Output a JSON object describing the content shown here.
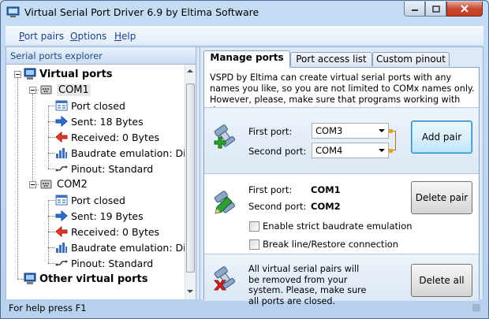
{
  "window": {
    "title": "Virtual Serial Port Driver 6.9 by Eltima Software"
  },
  "menu": {
    "items": [
      {
        "label": "Port pairs",
        "accel": "P",
        "rest": "ort pairs"
      },
      {
        "label": "Options",
        "accel": "O",
        "rest": "ptions"
      },
      {
        "label": "Help",
        "accel": "H",
        "rest": "elp"
      }
    ]
  },
  "explorer": {
    "header": "Serial ports explorer",
    "root_virtual": "Virtual ports",
    "root_other": "Other virtual ports",
    "ports": [
      {
        "name": "COM1",
        "items": [
          {
            "icon": "port-closed-icon",
            "label": "Port closed"
          },
          {
            "icon": "sent-arrow-icon",
            "label": "Sent: 18 Bytes"
          },
          {
            "icon": "received-arrow-icon",
            "label": "Received: 0 Bytes"
          },
          {
            "icon": "baudrate-icon",
            "label": "Baudrate emulation: Dis"
          },
          {
            "icon": "pinout-icon",
            "label": "Pinout: Standard"
          }
        ]
      },
      {
        "name": "COM2",
        "items": [
          {
            "icon": "port-closed-icon",
            "label": "Port closed"
          },
          {
            "icon": "sent-arrow-icon",
            "label": "Sent: 19 Bytes"
          },
          {
            "icon": "received-arrow-icon",
            "label": "Received: 0 Bytes"
          },
          {
            "icon": "baudrate-icon",
            "label": "Baudrate emulation: Dis"
          },
          {
            "icon": "pinout-icon",
            "label": "Pinout: Standard"
          }
        ]
      }
    ]
  },
  "tabs": [
    {
      "label": "Manage ports",
      "active": true
    },
    {
      "label": "Port access list",
      "active": false
    },
    {
      "label": "Custom pinout",
      "active": false
    }
  ],
  "manage": {
    "intro": "VSPD by Eltima can create virtual serial ports with any names you like, so you are not limited to COMx names only. However, please, make sure that programs working with these ports support custom port names.",
    "add": {
      "first_label": "First port:",
      "first_value": "COM3",
      "second_label": "Second port:",
      "second_value": "COM4",
      "button": "Add pair"
    },
    "delete": {
      "first_label": "First port:",
      "first_value": "COM1",
      "second_label": "Second port:",
      "second_value": "COM2",
      "button": "Delete pair",
      "strict_baud_label": "Enable strict baudrate emulation",
      "break_line_label": "Break line/Restore connection"
    },
    "delete_all": {
      "text": "All virtual serial pairs will be removed from your system. Please, make sure all ports are closed.",
      "button": "Delete all"
    }
  },
  "status": {
    "text": "For help press F1"
  },
  "colors": {
    "accent_blue": "#1f4a84",
    "menu_text": "#1a3f8c",
    "close_red": "#c74a32"
  }
}
